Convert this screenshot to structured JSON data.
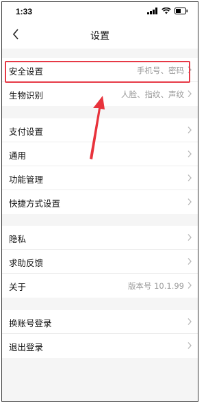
{
  "status_bar": {
    "time": "1:33"
  },
  "nav": {
    "title": "设置"
  },
  "groups": [
    {
      "items": [
        {
          "label": "安全设置",
          "value": "手机号、密码"
        },
        {
          "label": "生物识别",
          "value": "人脸、指纹、声纹"
        }
      ]
    },
    {
      "items": [
        {
          "label": "支付设置",
          "value": ""
        },
        {
          "label": "通用",
          "value": ""
        },
        {
          "label": "功能管理",
          "value": ""
        },
        {
          "label": "快捷方式设置",
          "value": ""
        }
      ]
    },
    {
      "items": [
        {
          "label": "隐私",
          "value": ""
        },
        {
          "label": "求助反馈",
          "value": ""
        },
        {
          "label": "关于",
          "value": "版本号 10.1.99"
        }
      ]
    },
    {
      "items": [
        {
          "label": "换账号登录",
          "value": ""
        },
        {
          "label": "退出登录",
          "value": ""
        }
      ]
    }
  ],
  "colors": {
    "highlight": "#e63946",
    "arrow": "#e8333c"
  }
}
